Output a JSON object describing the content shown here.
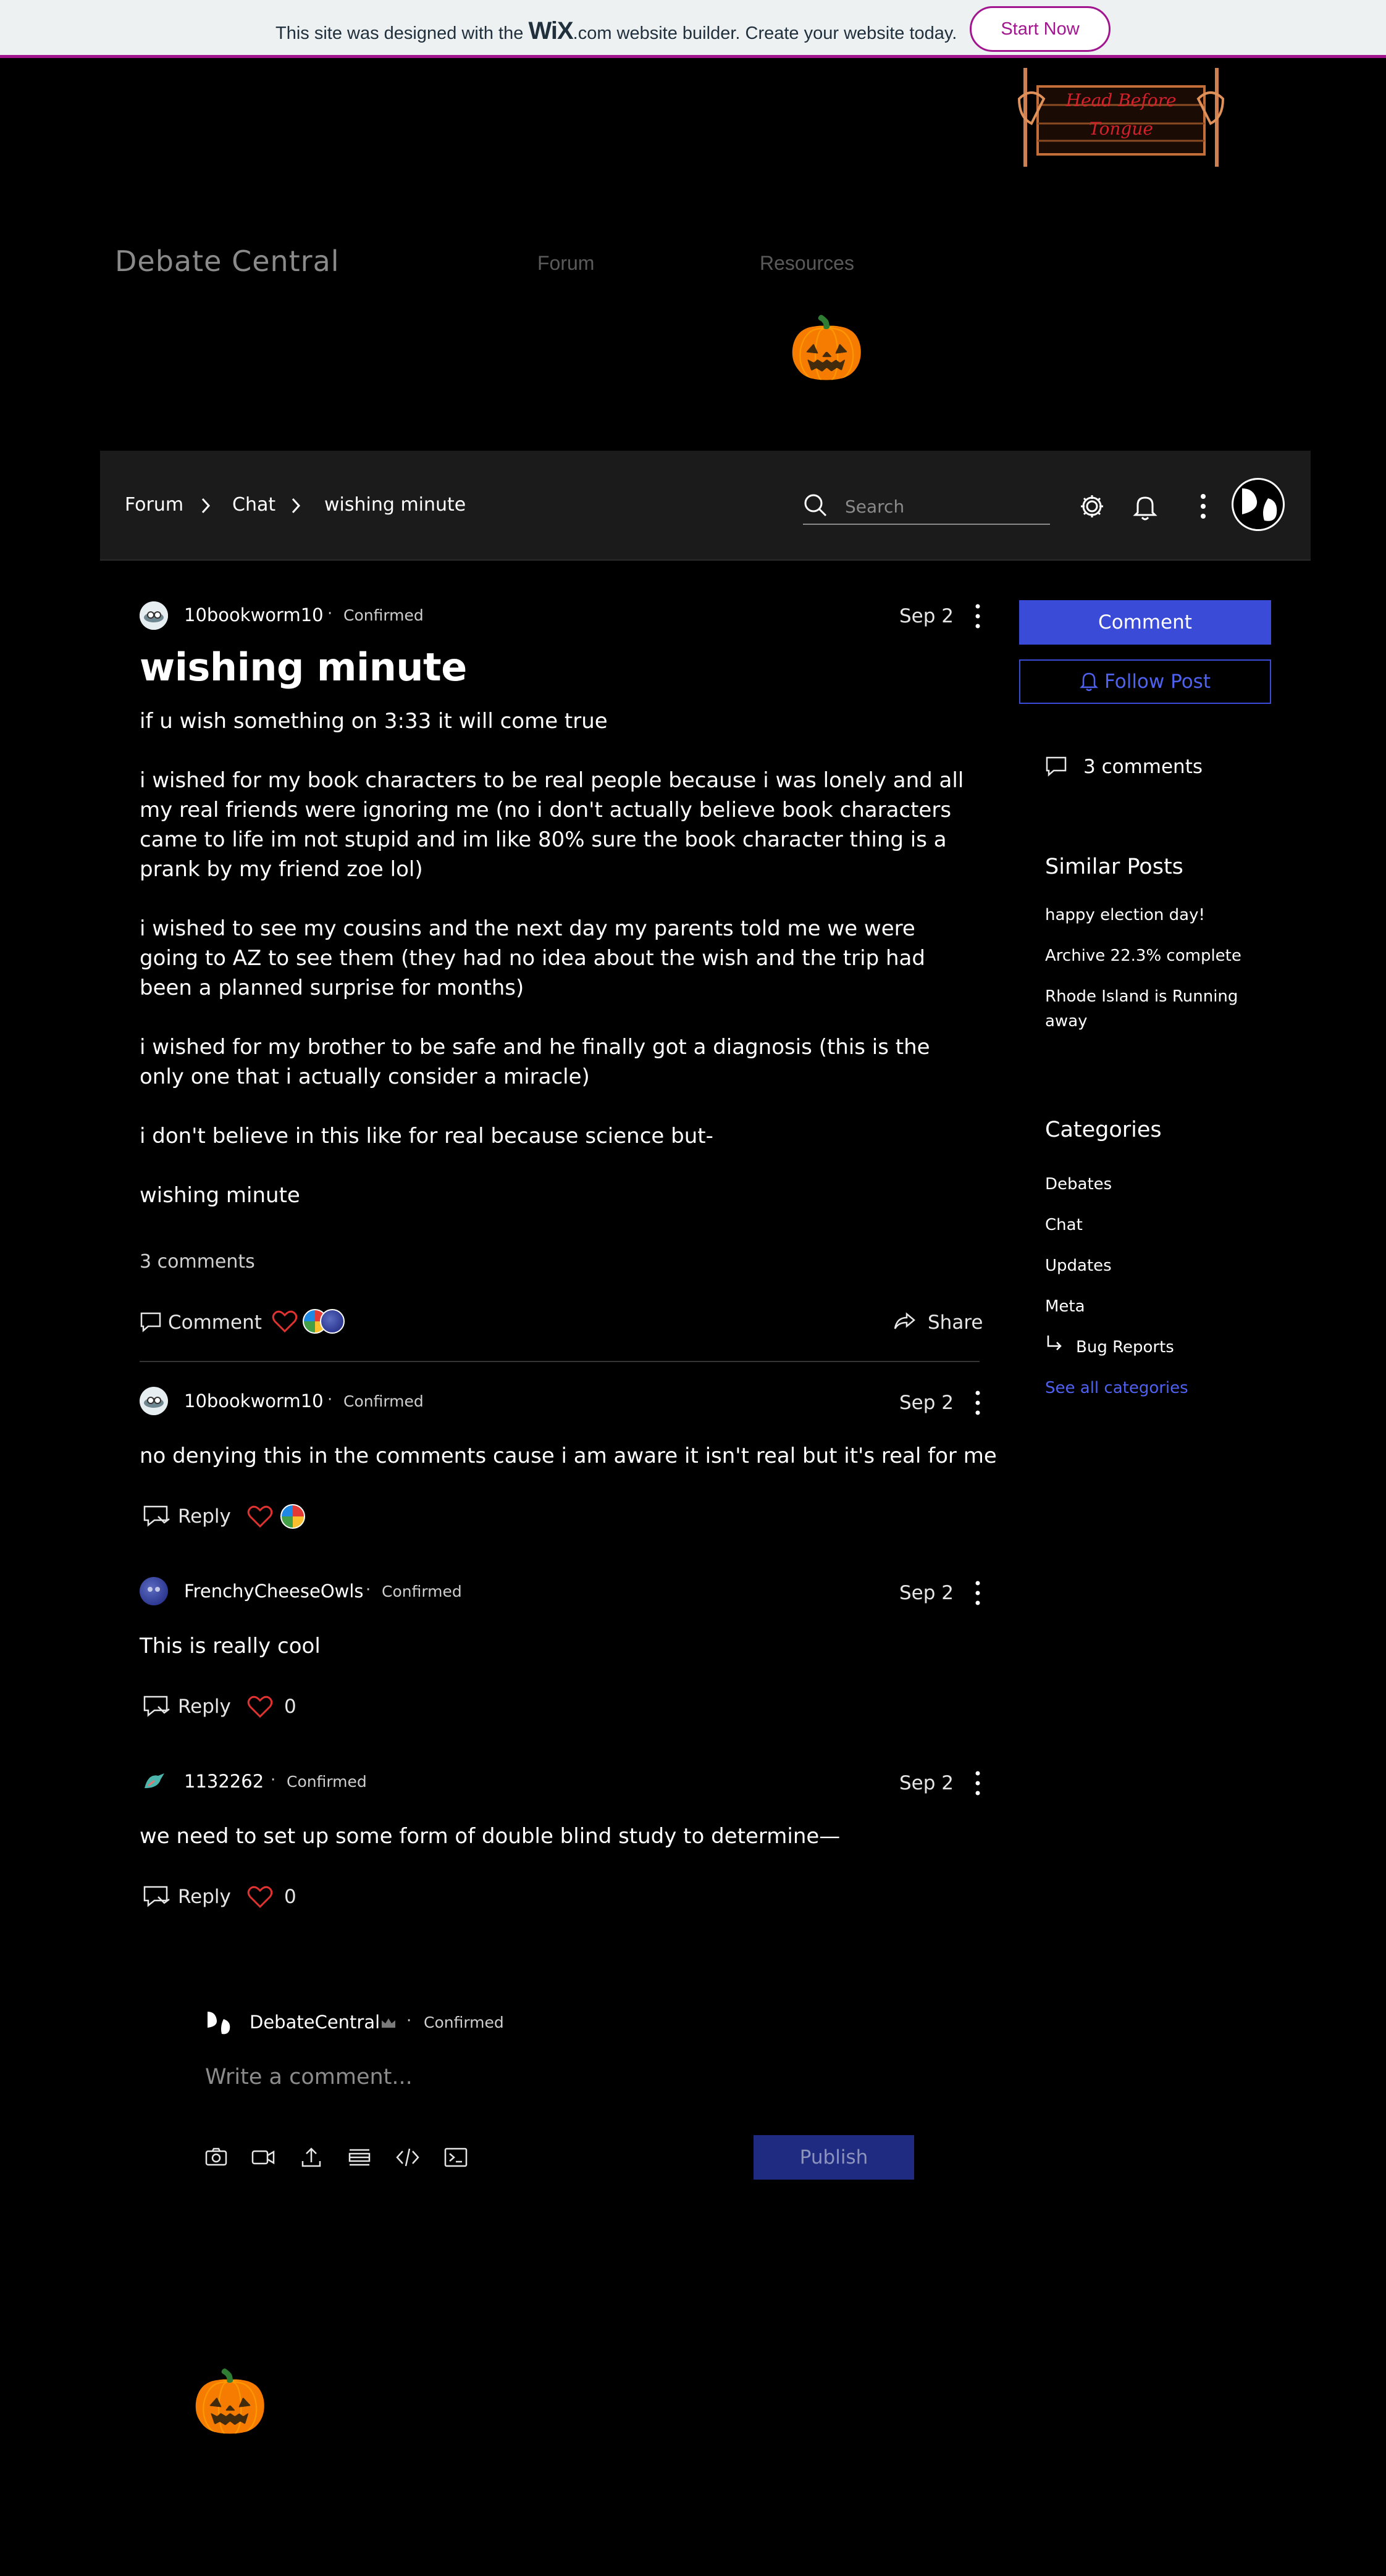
{
  "banner": {
    "text_before": "This site was designed with the",
    "logo": "WiX",
    "text_after": ".com website builder. Create your website today.",
    "cta": "Start Now"
  },
  "site": {
    "title": "Debate Central",
    "nav": [
      "Forum",
      "Resources"
    ],
    "header_logo_text_1": "Head Before",
    "header_logo_text_2": "Tongue"
  },
  "breadcrumb": [
    "Forum",
    "Chat",
    "wishing minute"
  ],
  "search": {
    "placeholder": "Search"
  },
  "post": {
    "author": "10bookworm10",
    "badge": "Confirmed",
    "date": "Sep 2",
    "title": "wishing minute",
    "paragraphs": [
      "if u wish something on 3:33 it will come true",
      "i wished for my book characters to be real people because i was lonely and all my real friends were ignoring me (no i don't actually believe book characters came to life im not stupid and im like 80% sure the book character thing is a prank by my friend zoe lol)",
      "i wished to see my cousins and the next day my parents told me we were going to AZ to see them (they had no idea about the wish and the trip had been a planned surprise for months)",
      "i wished for my brother to be safe and he finally got a diagnosis (this is the only one that i actually consider a miracle)",
      "i don't believe in this like for real because science but-",
      "wishing minute"
    ],
    "comments_count": "3 comments",
    "comment_label": "Comment",
    "share_label": "Share"
  },
  "comments": [
    {
      "author": "10bookworm10",
      "badge": "Confirmed",
      "date": "Sep 2",
      "text": "no denying this in the comments cause i am aware it isn't real but it's real for me",
      "reply": "Reply",
      "likes": ""
    },
    {
      "author": "FrenchyCheeseOwls",
      "badge": "Confirmed",
      "date": "Sep 2",
      "text": "This is really cool",
      "reply": "Reply",
      "likes": "0"
    },
    {
      "author": "1132262",
      "badge": "Confirmed",
      "date": "Sep 2",
      "text": "we need to set up some form of double blind study to determine—",
      "reply": "Reply",
      "likes": "0"
    }
  ],
  "sidebar": {
    "comment_button": "Comment",
    "follow_button": "Follow Post",
    "comments_count": "3 comments",
    "similar_title": "Similar Posts",
    "similar": [
      "happy election day!",
      "Archive 22.3% complete",
      "Rhode Island is Running away"
    ],
    "categories_title": "Categories",
    "categories": [
      "Debates",
      "Chat",
      "Updates",
      "Meta",
      "Bug Reports"
    ],
    "see_all": "See all categories"
  },
  "composer": {
    "author": "DebateCentral",
    "badge": "Confirmed",
    "placeholder": "Write a comment...",
    "publish": "Publish"
  },
  "colors": {
    "accent": "#3a4bd8",
    "wix_magenta": "#a1168f",
    "heart": "#e0322f"
  }
}
